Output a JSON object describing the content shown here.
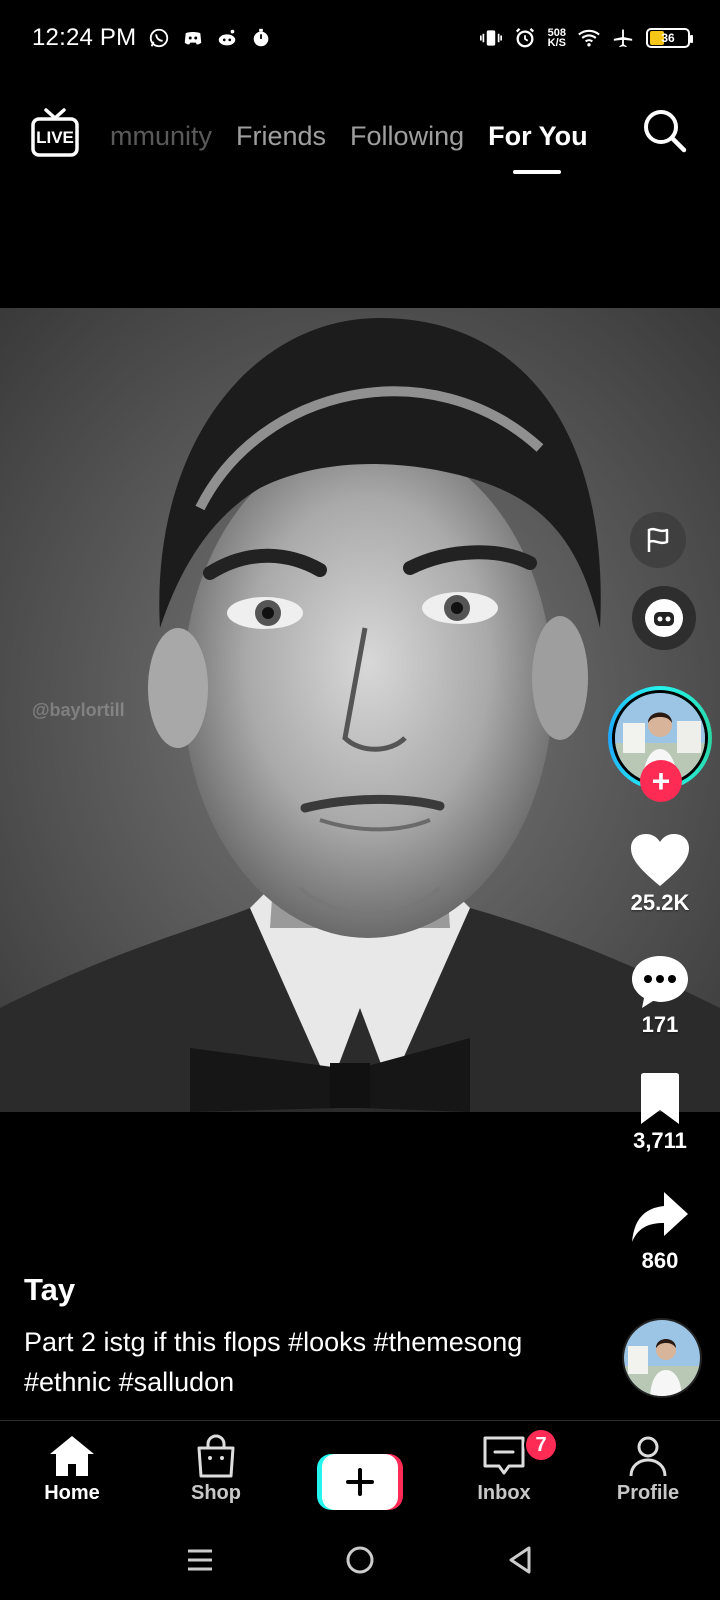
{
  "status_bar": {
    "time": "12:24 PM",
    "net_speed_value": "508",
    "net_speed_unit": "K/S",
    "battery_level": "36",
    "left_icons": [
      "whatsapp-icon",
      "discord-icon",
      "reddit-icon",
      "stopwatch-icon"
    ],
    "right_icons": [
      "vibrate-icon",
      "alarm-icon",
      "wifi-icon",
      "airplane-icon",
      "battery-icon"
    ]
  },
  "top_nav": {
    "live_label": "LIVE",
    "tabs": [
      {
        "label": "mmunity",
        "state": "partially-visible"
      },
      {
        "label": "Friends",
        "state": "inactive"
      },
      {
        "label": "Following",
        "state": "inactive"
      },
      {
        "label": "For You",
        "state": "active"
      }
    ]
  },
  "video": {
    "watermark": "@baylortill"
  },
  "actions": {
    "likes": "25.2K",
    "comments": "171",
    "saves": "3,711",
    "shares": "860"
  },
  "caption": {
    "author": "Tay",
    "description": "Part 2 istg if this flops #looks #themesong #ethnic #salludon"
  },
  "bottom_nav": {
    "items": [
      {
        "label": "Home"
      },
      {
        "label": "Shop"
      },
      {
        "label": ""
      },
      {
        "label": "Inbox",
        "badge": "7"
      },
      {
        "label": "Profile"
      }
    ]
  },
  "colors": {
    "accent_pink": "#fe2c55",
    "accent_cyan": "#25f4ee",
    "battery": "#f5c518"
  }
}
